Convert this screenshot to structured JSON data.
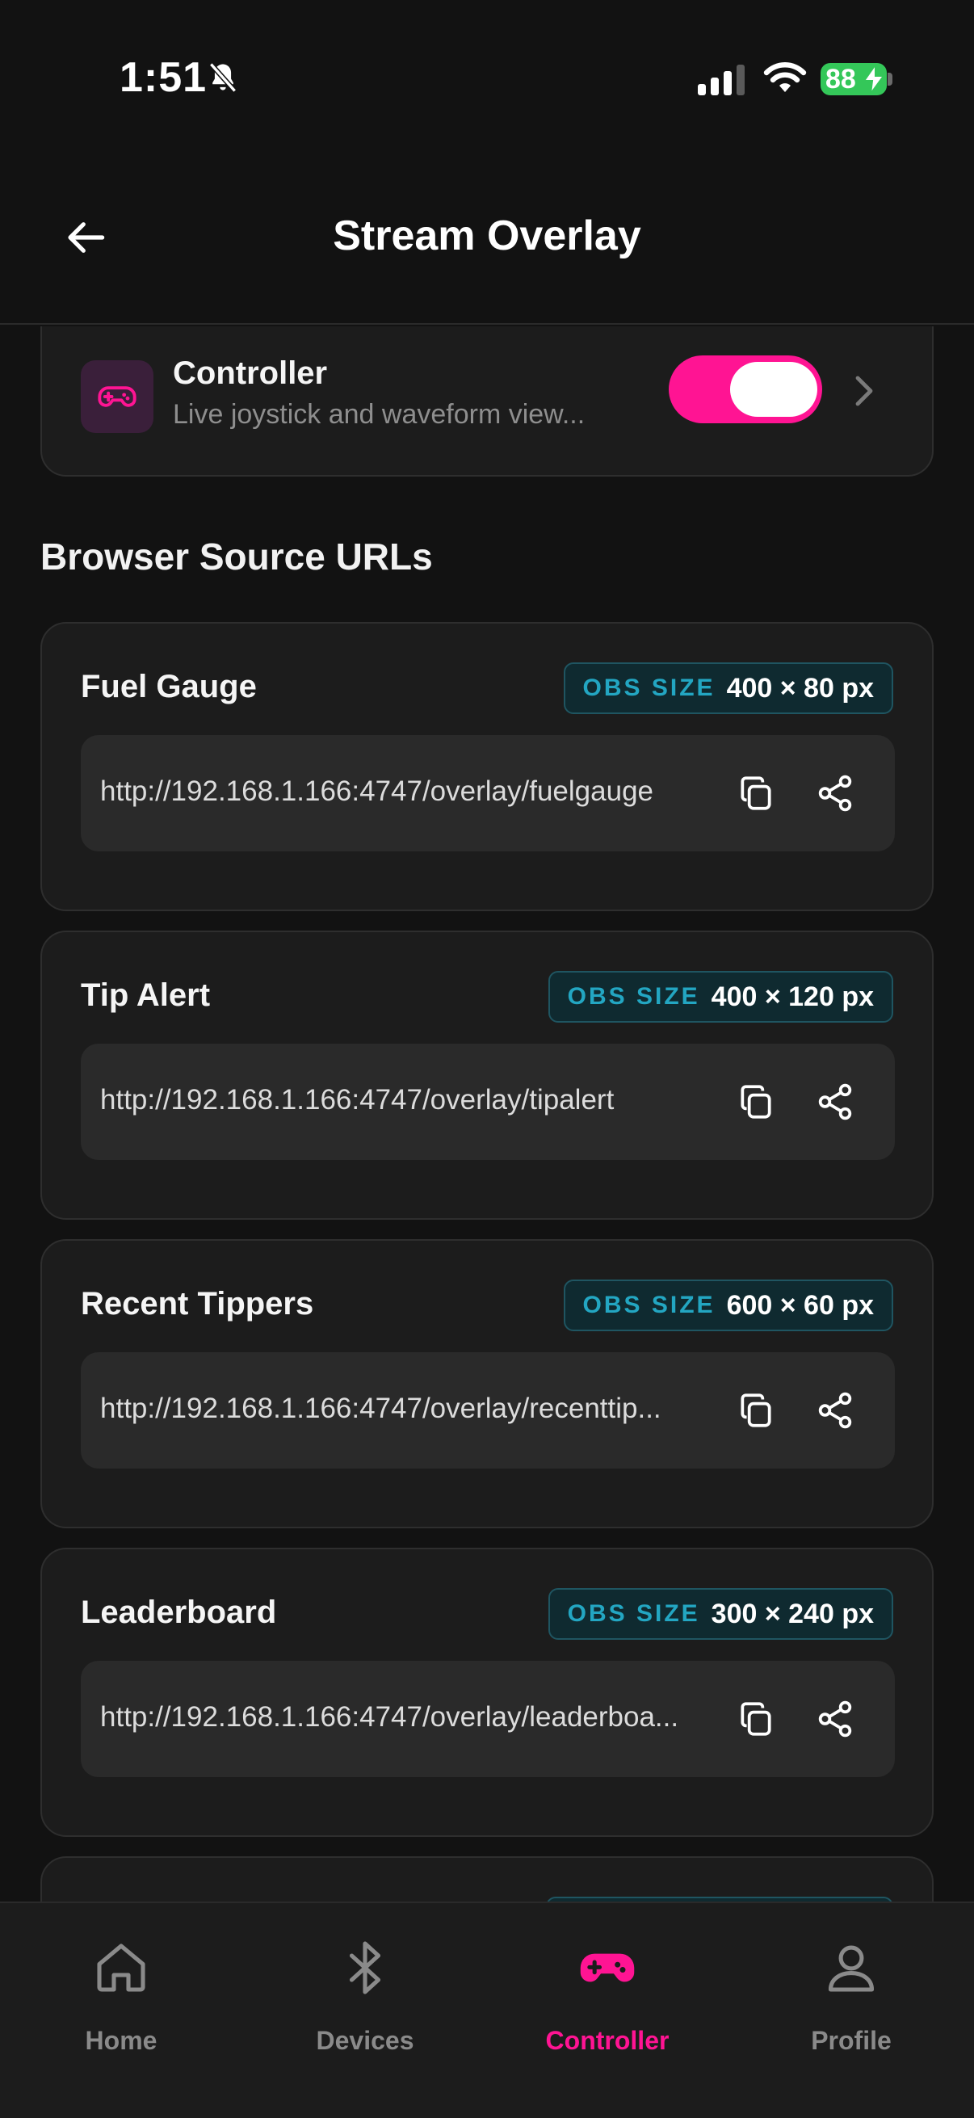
{
  "status_bar": {
    "time": "1:51",
    "battery": "88"
  },
  "header": {
    "title": "Stream Overlay"
  },
  "controller_card": {
    "title": "Controller",
    "subtitle": "Live joystick and waveform view...",
    "enabled": true
  },
  "section": {
    "title": "Browser Source URLs"
  },
  "sources": [
    {
      "name": "Fuel Gauge",
      "badge_label": "OBS SIZE",
      "size": "400 × 80 px",
      "url": "http://192.168.1.166:4747/overlay/fuelgauge"
    },
    {
      "name": "Tip Alert",
      "badge_label": "OBS SIZE",
      "size": "400 × 120 px",
      "url": "http://192.168.1.166:4747/overlay/tipalert"
    },
    {
      "name": "Recent Tippers",
      "badge_label": "OBS SIZE",
      "size": "600 × 60 px",
      "url": "http://192.168.1.166:4747/overlay/recenttip..."
    },
    {
      "name": "Leaderboard",
      "badge_label": "OBS SIZE",
      "size": "300 × 240 px",
      "url": "http://192.168.1.166:4747/overlay/leaderboa..."
    }
  ],
  "nav": {
    "items": [
      {
        "label": "Home",
        "icon": "home-icon"
      },
      {
        "label": "Devices",
        "icon": "bluetooth-icon"
      },
      {
        "label": "Controller",
        "icon": "gamepad-icon",
        "active": true
      },
      {
        "label": "Profile",
        "icon": "person-icon"
      }
    ]
  },
  "colors": {
    "accent": "#ff1493",
    "badge": "#23a6c2",
    "background": "#121212",
    "card": "#1c1c1c"
  }
}
